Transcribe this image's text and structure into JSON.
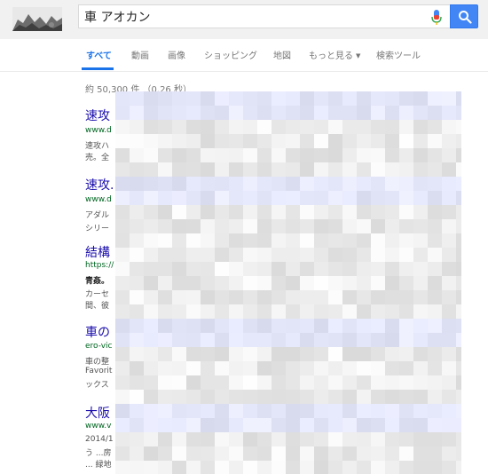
{
  "search": {
    "query": "車 アオカン"
  },
  "tabs": [
    {
      "label": "すべて",
      "active": true
    },
    {
      "label": "動画",
      "active": false
    },
    {
      "label": "画像",
      "active": false
    },
    {
      "label": "ショッピング",
      "active": false
    },
    {
      "label": "地図",
      "active": false
    },
    {
      "label": "もっと見る",
      "active": false
    },
    {
      "label": "検索ツール",
      "active": false
    }
  ],
  "result_stats": "約 50,300 件 （0.26 秒）",
  "results": [
    {
      "title": "速攻",
      "url": "www.d",
      "snippets": [
        "速攻ハ",
        "売。全"
      ]
    },
    {
      "title": "速攻.",
      "url": "www.d",
      "snippets": [
        "アダル",
        "シリー"
      ]
    },
    {
      "title": "結構",
      "url": "https://",
      "snippets": [
        "青姦。",
        "カーセ",
        "間、彼"
      ]
    },
    {
      "title": "車の",
      "url": "ero-vic",
      "snippets": [
        "車の整",
        "Favorit",
        "ックス"
      ]
    },
    {
      "title": "大阪",
      "url": "www.v",
      "snippets": [
        "2014/1",
        "う ...房",
        "... 緑地"
      ]
    }
  ],
  "colors": {
    "accent": "#1a73e8",
    "link": "#1a0dab",
    "url": "#006621",
    "search_button": "#4285f4",
    "header_bg": "#f1f1f1"
  },
  "icons": {
    "mic": "microphone-icon",
    "search": "magnifier-icon"
  }
}
